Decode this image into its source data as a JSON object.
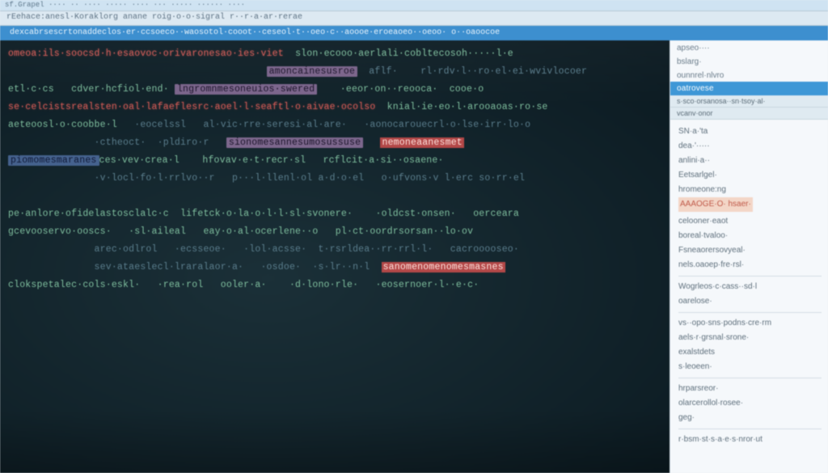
{
  "titlebar": "sf.Grapel   ····  ·· ···· ····· ···· ···  ·····  ······ ····",
  "tabbar": "rEehace:anesl·Koraklorg   anane roig·o·o·sigral   r··r·a·ar·rerae",
  "statusstrip": "dexcabrsescrtonaddeclos·er·ccsoeco··waosotol·cooot··ceseol·t··oeo·c··aoooe·eroeaoeo··oeoo·  o··oaoocoe",
  "code": [
    {
      "cls": "errline",
      "segs": [
        {
          "c": "kw",
          "t": "omeoa:ils·soocsd·h·esaovoc·orivaronesao·ies·viet"
        },
        {
          "c": "op",
          "t": "  "
        },
        {
          "c": "op",
          "t": "slon·ecooo·aerlali·cobltecosoh·····l·e"
        }
      ]
    },
    {
      "segs": [
        {
          "c": "cmt",
          "t": "                                             "
        },
        {
          "c": "sel",
          "t": "amoncainesusroe"
        },
        {
          "c": "cmt",
          "t": "  aflf·    rl·rdv·l··ro·el·ei·wvivlocoer"
        }
      ]
    },
    {
      "segs": [
        {
          "c": "op",
          "t": "etl·c·cs   cdver·hcfiol·end· "
        },
        {
          "c": "sel",
          "t": "lngromnmesoneuios·swered"
        },
        {
          "c": "op",
          "t": "    ·eeor·on··reooca·  cooe·o   "
        }
      ]
    },
    {
      "cls": "errline",
      "segs": [
        {
          "c": "kw",
          "t": "se·celcistsrealsten·oal·lafaeflesrc·aoel·l·seaftl·o·aivae·ocolso"
        },
        {
          "c": "op",
          "t": "  knial·ie·eo·l·arooaoas·ro·se"
        }
      ]
    },
    {
      "segs": [
        {
          "c": "op",
          "t": "aeteoosl·o·coobbe·l   "
        },
        {
          "c": "cmt",
          "t": "·eocelssl   al·vic·rre·seresi·al·are·   ·aonocarouecrl·o·lse·irr·lo·o"
        }
      ]
    },
    {
      "segs": [
        {
          "c": "cmt",
          "t": "               ·ctheoct·  ·pldiro·r   "
        },
        {
          "c": "sel",
          "t": "sionomesannesumosussuse"
        },
        {
          "c": "op",
          "t": "   "
        },
        {
          "c": "err",
          "t": "nemoneaanesmet"
        }
      ]
    },
    {
      "segs": [
        {
          "c": "sel-blue",
          "t": "piomomesmaranes"
        },
        {
          "c": "op",
          "t": "ces·vev·crea·l    hfovav·e·t·recr·sl   rcflcit·a·si··osaene·"
        }
      ]
    },
    {
      "segs": [
        {
          "c": "cmt",
          "t": "               ·v·locl·fo·l·rrlvo··r   p···l·llenl·ol a·d·o·el   o·ufvons·v l·erc so·rr·el"
        }
      ]
    },
    {
      "segs": []
    },
    {
      "segs": [
        {
          "c": "op",
          "t": "pe·anlore·ofidelastosclalc·c  lifetck·o·la·o·l·l·sl·svonere·    ·oldcst·onsen·   oerceara"
        }
      ]
    },
    {
      "segs": [
        {
          "c": "op",
          "t": "gcevooservo·ooscs·   ·sl·aileal   eay·o·al·ocerlene··o   pl·ct·oordrsorsan··lo·ov"
        }
      ]
    },
    {
      "segs": [
        {
          "c": "cmt",
          "t": "               arec·odlrol   ·ecsseoe·   ·lol·acsse·  t·rsrldea··rr·rrl·l·   cacrooooseo·"
        }
      ]
    },
    {
      "segs": [
        {
          "c": "cmt",
          "t": "               sev·ataeslecl·lraralaor·a·   ·osdoe·  ·s·lr··n·l  "
        },
        {
          "c": "err",
          "t": "sanomenomenomesmasnes"
        }
      ]
    },
    {
      "segs": [
        {
          "c": "op",
          "t": "clokspetalec·cols·eskl·   ·rea·rol   ooler·a·    ·d·lono·rle·   ·eosernoer·l··e·c·"
        }
      ]
    }
  ],
  "sidebar": {
    "top": [
      "apseo····",
      "bslarg·",
      "ounnrel·nlvro"
    ],
    "header": "oatrovese",
    "sub": "s·sco·orsanosa··sn·tsoy·al·",
    "group1_title": "vcanv·onor",
    "items": [
      "SN·a·'ta",
      "dea·'·····",
      "anlini·a··",
      "Eetsarlgel·",
      "hromeone:ng",
      {
        "hl": true,
        "t": "AAAOGE·O· hsaer·"
      },
      "celooner·eaot",
      "boreal·tvaloo·",
      "Fsneaorersovyeal·",
      "nels.oaoep·fre·rsl·",
      "",
      "Wogrleos·c·cass··sd·l",
      "oarelose·",
      "",
      "vs··opo·sns·podns·cre·rm",
      "aels·r·grsnal·srone·",
      "exalstdets",
      "s·leoeen·",
      "",
      "hrparsreor·",
      "olarcerollol·rosee·",
      "geg·",
      "",
      "r·bsm·st·s·a·e·s·nror·ut"
    ]
  }
}
